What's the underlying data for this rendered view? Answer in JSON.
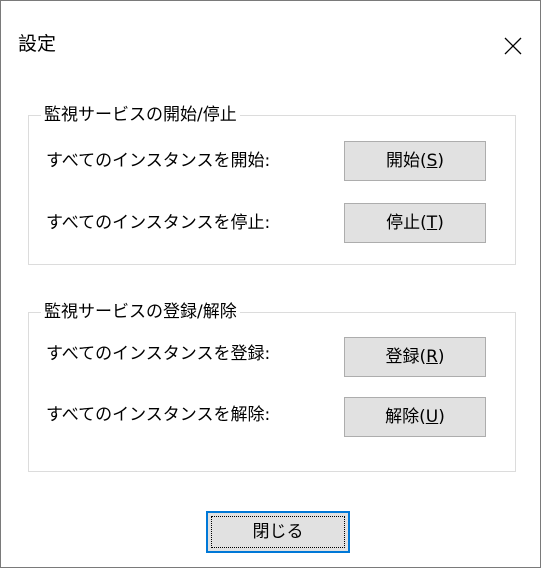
{
  "window": {
    "title": "設定",
    "close_glyph": "✕"
  },
  "group_start_stop": {
    "legend": "監視サービスの開始/停止",
    "rows": [
      {
        "label": "すべてのインスタンスを開始:",
        "button": "開始",
        "accel": "S"
      },
      {
        "label": "すべてのインスタンスを停止:",
        "button": "停止",
        "accel": "T"
      }
    ]
  },
  "group_register": {
    "legend": "監視サービスの登録/解除",
    "rows": [
      {
        "label": "すべてのインスタンスを登録:",
        "button": "登録",
        "accel": "R"
      },
      {
        "label": "すべてのインスタンスを解除:",
        "button": "解除",
        "accel": "U"
      }
    ]
  },
  "footer": {
    "close_label": "閉じる"
  },
  "colors": {
    "button_face": "#e1e1e1",
    "button_border": "#adadad",
    "default_button_border": "#0078d7",
    "group_border": "#dcdcdc"
  }
}
